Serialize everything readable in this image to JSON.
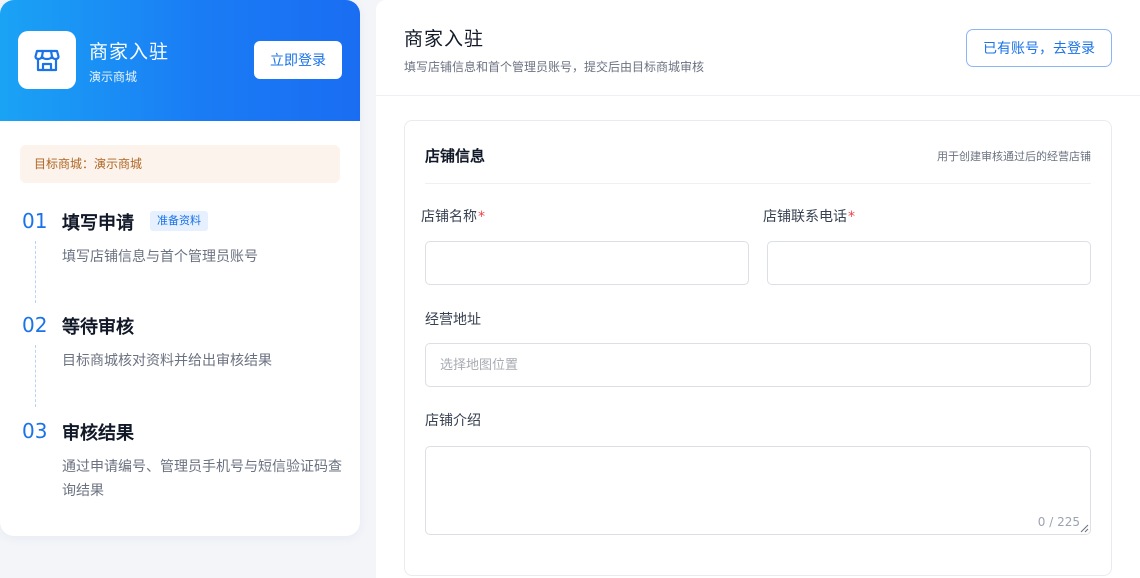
{
  "sidebar": {
    "brand_title": "商家入驻",
    "brand_subtitle": "演示商城",
    "login_button": "立即登录",
    "target_mall": "目标商城：演示商城",
    "steps": [
      {
        "number": "01",
        "title": "填写申请",
        "badge": "准备资料",
        "desc": "填写店铺信息与首个管理员账号"
      },
      {
        "number": "02",
        "title": "等待审核",
        "desc": "目标商城核对资料并给出审核结果"
      },
      {
        "number": "03",
        "title": "审核结果",
        "desc": "通过申请编号、管理员手机号与短信验证码查询结果"
      }
    ]
  },
  "header": {
    "title": "商家入驻",
    "subtitle": "填写店铺信息和首个管理员账号，提交后由目标商城审核",
    "have_account_button": "已有账号，去登录"
  },
  "form": {
    "section_title": "店铺信息",
    "section_hint": "用于创建审核通过后的经营店铺",
    "fields": {
      "shop_name": {
        "label": "店铺名称",
        "required_mark": "*",
        "value": ""
      },
      "shop_phone": {
        "label": "店铺联系电话",
        "required_mark": "*",
        "value": ""
      },
      "address": {
        "label": "经营地址",
        "placeholder": "选择地图位置",
        "value": ""
      },
      "intro": {
        "label": "店铺介绍",
        "value": "",
        "counter": "0 / 225"
      }
    }
  },
  "colors": {
    "primary": "#1a73e8",
    "header_gradient_start": "#1aa3f5",
    "header_gradient_end": "#1a6df2",
    "tip_background": "#fbf3ec",
    "tip_text": "#b06624",
    "required": "#ef4444"
  },
  "icons": {
    "brand_logo": "storefront-icon"
  }
}
